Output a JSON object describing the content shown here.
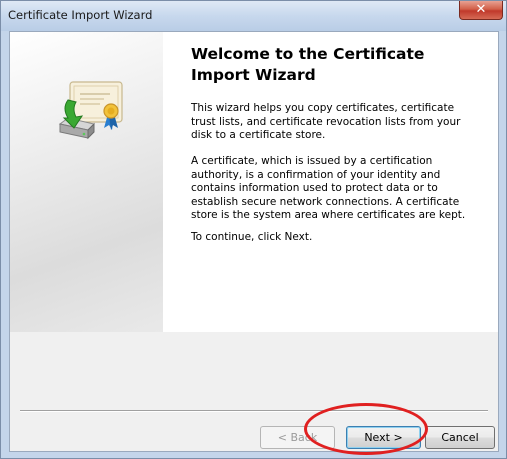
{
  "window": {
    "title": "Certificate Import Wizard",
    "close_label": "✕"
  },
  "content": {
    "heading": "Welcome to the Certificate Import Wizard",
    "paragraph1": "This wizard helps you copy certificates, certificate trust lists, and certificate revocation lists from your disk to a certificate store.",
    "paragraph2": "A certificate, which is issued by a certification authority, is a confirmation of your identity and contains information used to protect data or to establish secure network connections. A certificate store is the system area where certificates are kept.",
    "paragraph3": "To continue, click Next."
  },
  "buttons": {
    "back_label": "< Back",
    "next_label": "Next >",
    "cancel_label": "Cancel"
  },
  "icons": {
    "wizard_icon": "certificate-import-icon",
    "close": "close-icon"
  },
  "colors": {
    "annotation_circle": "#e02020",
    "close_button": "#c0392b",
    "arrow_green": "#3aa832"
  }
}
